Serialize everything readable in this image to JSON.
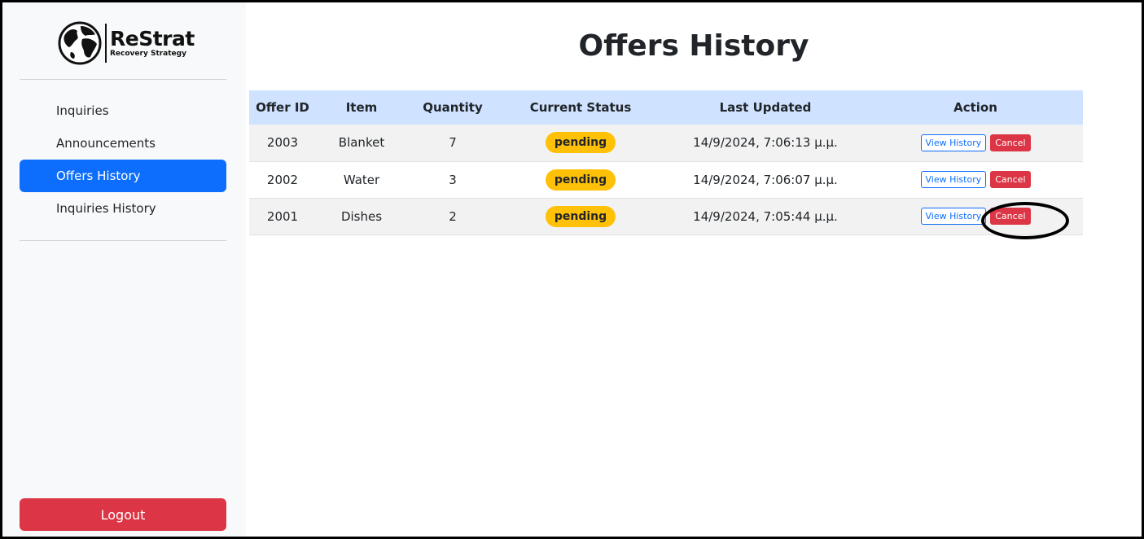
{
  "brand": {
    "name": "ReStrat",
    "tagline": "Recovery Strategy"
  },
  "sidebar": {
    "items": [
      {
        "label": "Inquiries"
      },
      {
        "label": "Announcements"
      },
      {
        "label": "Offers History",
        "active": true
      },
      {
        "label": "Inquiries History"
      }
    ],
    "logout_label": "Logout"
  },
  "page": {
    "title": "Offers History"
  },
  "table": {
    "columns": [
      "Offer ID",
      "Item",
      "Quantity",
      "Current Status",
      "Last Updated",
      "Action"
    ],
    "rows": [
      {
        "id": "2003",
        "item": "Blanket",
        "quantity": "7",
        "status": "pending",
        "updated": "14/9/2024, 7:06:13 μ.μ.",
        "view_label": "View History",
        "cancel_label": "Cancel"
      },
      {
        "id": "2002",
        "item": "Water",
        "quantity": "3",
        "status": "pending",
        "updated": "14/9/2024, 7:06:07 μ.μ.",
        "view_label": "View History",
        "cancel_label": "Cancel"
      },
      {
        "id": "2001",
        "item": "Dishes",
        "quantity": "2",
        "status": "pending",
        "updated": "14/9/2024, 7:05:44 μ.μ.",
        "view_label": "View History",
        "cancel_label": "Cancel"
      }
    ]
  },
  "colors": {
    "primary": "#0d6efd",
    "danger": "#dc3545",
    "warning": "#ffc107",
    "table_header": "#cfe2ff",
    "sidebar_bg": "#f8f9fa"
  },
  "icons": {
    "logo": "globe-icon"
  }
}
